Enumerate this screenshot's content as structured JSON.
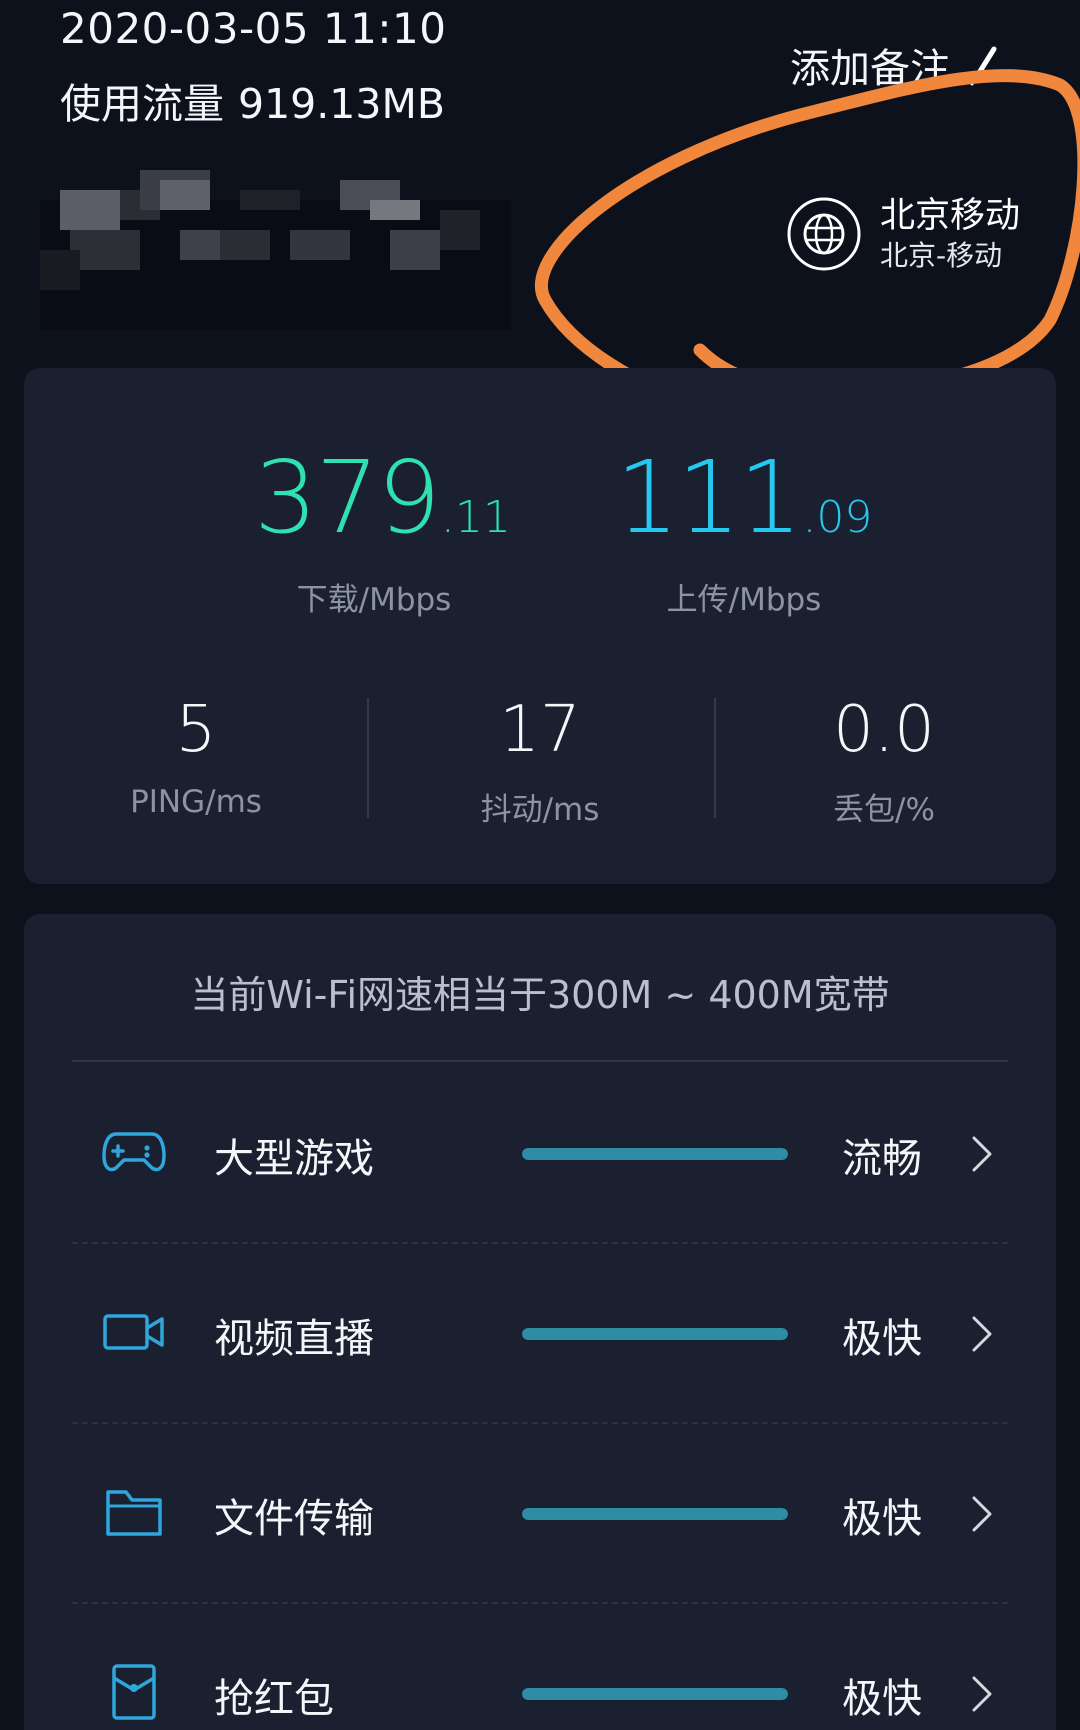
{
  "header": {
    "datetime": "2020-03-05 11:10",
    "traffic_label": "使用流量",
    "traffic_value": "919.13MB",
    "add_note_label": "添加备注"
  },
  "isp": {
    "title": "北京移动",
    "subtitle": "北京-移动"
  },
  "speeds": {
    "download": {
      "int": "379",
      "dec": ".11",
      "label": "下载/Mbps"
    },
    "upload": {
      "int": "111",
      "dec": ".09",
      "label": "上传/Mbps"
    }
  },
  "metrics": [
    {
      "value": "5",
      "label": "PING/ms"
    },
    {
      "value": "17",
      "label": "抖动/ms"
    },
    {
      "value": "0.0",
      "label": "丢包/%"
    }
  ],
  "experience": {
    "summary": "当前Wi-Fi网速相当于300M ~ 400M宽带",
    "items": [
      {
        "title": "大型游戏",
        "rating": "流畅",
        "level": 1.0,
        "icon": "gamepad-icon"
      },
      {
        "title": "视频直播",
        "rating": "极快",
        "level": 1.0,
        "icon": "video-camera-icon"
      },
      {
        "title": "文件传输",
        "rating": "极快",
        "level": 1.0,
        "icon": "folder-icon"
      },
      {
        "title": "抢红包",
        "rating": "极快",
        "level": 1.0,
        "icon": "red-packet-icon"
      }
    ]
  },
  "colors": {
    "background": "#0d111b",
    "card": "#1b2030",
    "download": "#2fe0b0",
    "upload": "#25c9ef",
    "icon": "#2fa6dc",
    "bar": "#2e8da4",
    "annotation": "#f0873c"
  }
}
